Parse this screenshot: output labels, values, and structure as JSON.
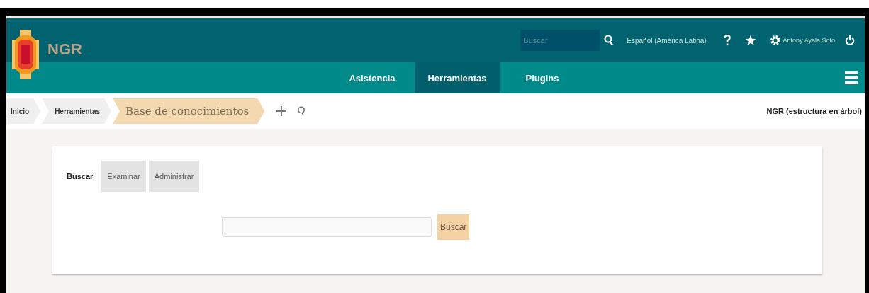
{
  "brand": "NGR",
  "top_search": {
    "placeholder": "Buscar"
  },
  "language": "Español (América Latina)",
  "user": "Antony Ayala Soto",
  "nav": [
    {
      "label": "Asistencia",
      "selected": false
    },
    {
      "label": "Herramientas",
      "selected": true
    },
    {
      "label": "Plugins",
      "selected": false
    }
  ],
  "breadcrumbs": [
    {
      "label": "Inicio",
      "current": false
    },
    {
      "label": "Herramientas",
      "current": false
    },
    {
      "label": "Base de conocimientos",
      "current": true
    }
  ],
  "tree_link": "NGR (estructura en árbol)",
  "tabs": [
    {
      "label": "Buscar",
      "selected": true
    },
    {
      "label": "Examinar",
      "selected": false
    },
    {
      "label": "Administrar",
      "selected": false
    }
  ],
  "search_button": "Buscar"
}
